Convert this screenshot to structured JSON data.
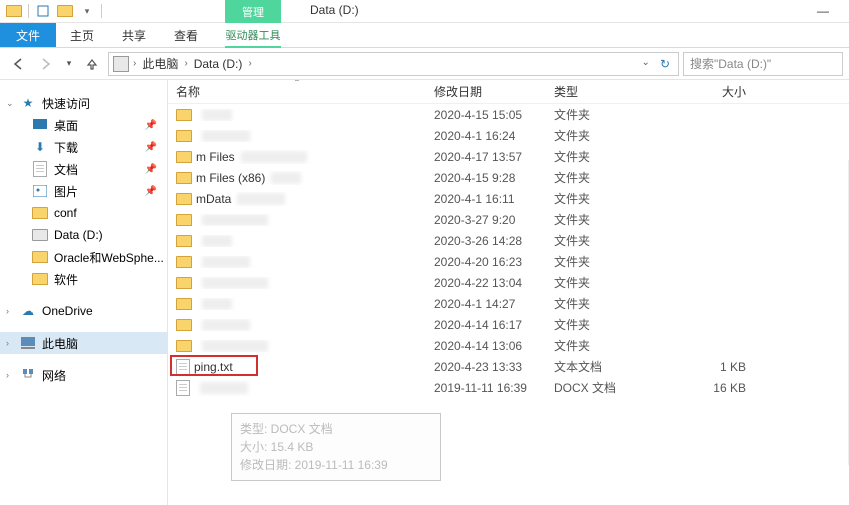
{
  "titlebar": {
    "manage_tab": "管理",
    "drive_tool": "驱动器工具",
    "title": "Data (D:)"
  },
  "ribbon": {
    "file": "文件",
    "home": "主页",
    "share": "共享",
    "view": "查看"
  },
  "nav": {
    "this_pc": "此电脑",
    "location": "Data (D:)",
    "search_placeholder": "搜索\"Data (D:)\""
  },
  "sidebar": {
    "quick_access": "快速访问",
    "desktop": "桌面",
    "downloads": "下载",
    "documents": "文档",
    "pictures": "图片",
    "conf": "conf",
    "data_d": "Data (D:)",
    "oracle": "Oracle和WebSphe...",
    "software": "软件",
    "onedrive": "OneDrive",
    "this_pc_label": "此电脑",
    "network": "网络"
  },
  "columns": {
    "name": "名称",
    "date": "修改日期",
    "type": "类型",
    "size": "大小"
  },
  "rows": [
    {
      "name": "",
      "date": "2020-4-15 15:05",
      "type": "文件夹",
      "size": "",
      "kind": "folder",
      "blurred": true
    },
    {
      "name": "",
      "date": "2020-4-1 16:24",
      "type": "文件夹",
      "size": "",
      "kind": "folder",
      "blurred": true
    },
    {
      "name": "m Files",
      "date": "2020-4-17 13:57",
      "type": "文件夹",
      "size": "",
      "kind": "folder",
      "blurred": true
    },
    {
      "name": "m Files (x86)",
      "date": "2020-4-15 9:28",
      "type": "文件夹",
      "size": "",
      "kind": "folder",
      "blurred": true
    },
    {
      "name": "mData",
      "date": "2020-4-1 16:11",
      "type": "文件夹",
      "size": "",
      "kind": "folder",
      "blurred": true
    },
    {
      "name": "",
      "date": "2020-3-27 9:20",
      "type": "文件夹",
      "size": "",
      "kind": "folder",
      "blurred": true
    },
    {
      "name": "",
      "date": "2020-3-26 14:28",
      "type": "文件夹",
      "size": "",
      "kind": "folder",
      "blurred": true
    },
    {
      "name": "",
      "date": "2020-4-20 16:23",
      "type": "文件夹",
      "size": "",
      "kind": "folder",
      "blurred": true
    },
    {
      "name": "",
      "date": "2020-4-22 13:04",
      "type": "文件夹",
      "size": "",
      "kind": "folder",
      "blurred": true
    },
    {
      "name": "",
      "date": "2020-4-1 14:27",
      "type": "文件夹",
      "size": "",
      "kind": "folder",
      "blurred": true
    },
    {
      "name": "",
      "date": "2020-4-14 16:17",
      "type": "文件夹",
      "size": "",
      "kind": "folder",
      "blurred": true
    },
    {
      "name": "",
      "date": "2020-4-14 13:06",
      "type": "文件夹",
      "size": "",
      "kind": "folder",
      "blurred": true
    },
    {
      "name": "ping.txt",
      "date": "2020-4-23 13:33",
      "type": "文本文档",
      "size": "1 KB",
      "kind": "file",
      "highlight": true
    },
    {
      "name": "",
      "date": "2019-11-11 16:39",
      "type": "DOCX 文档",
      "size": "16 KB",
      "kind": "file",
      "blurred": true
    }
  ],
  "tooltip": {
    "type_line": "类型: DOCX 文档",
    "size_line": "大小: 15.4 KB",
    "date_line": "修改日期: 2019-11-11 16:39"
  }
}
